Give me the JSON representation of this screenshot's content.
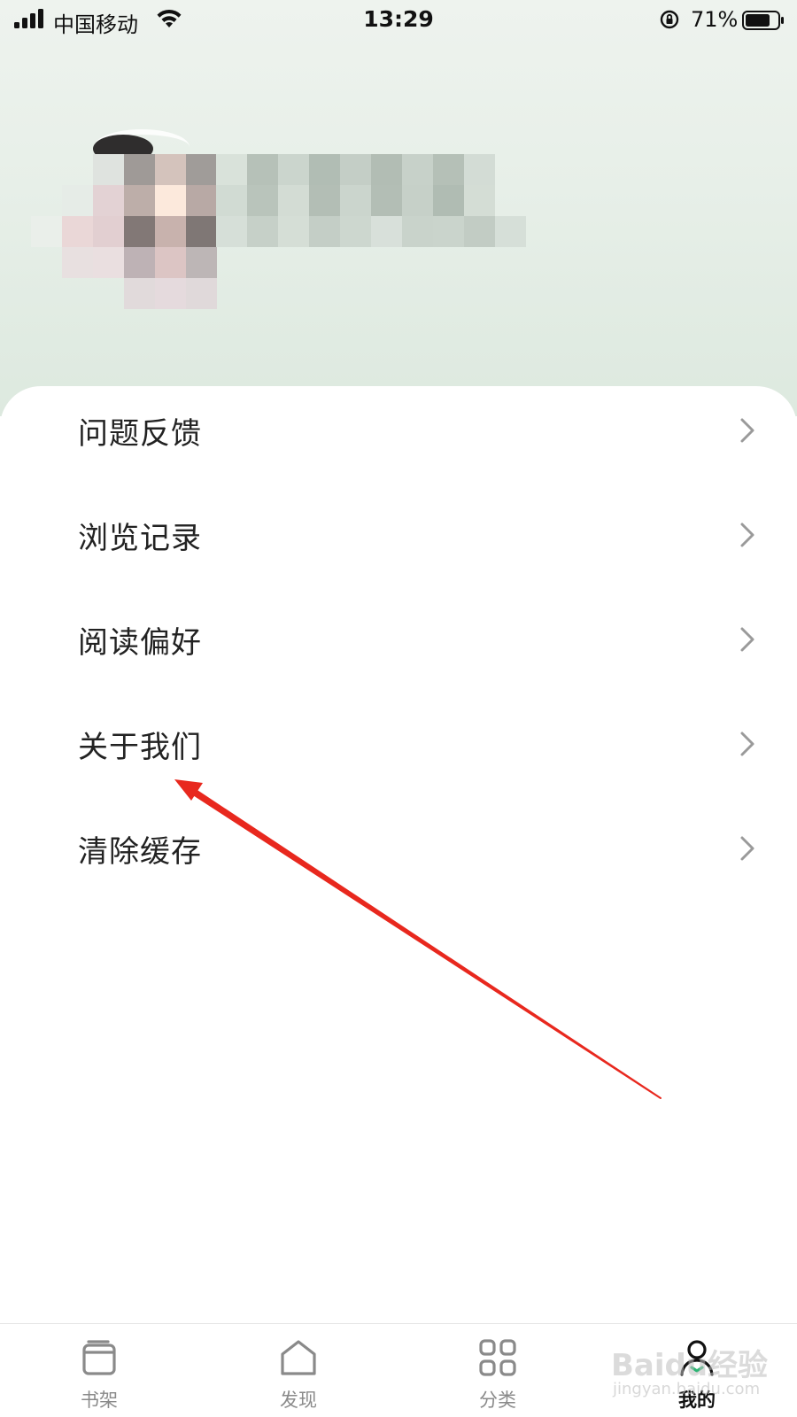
{
  "status_bar": {
    "carrier": "中国移动",
    "time": "13:29",
    "battery_percent": "71%",
    "icons": [
      "signal-icon",
      "wifi-icon",
      "rotation-lock-icon",
      "battery-icon"
    ]
  },
  "profile": {
    "avatar": "blurred-avatar",
    "username": ""
  },
  "menu": {
    "items": [
      {
        "label": "问题反馈",
        "icon": "chevron-right-icon"
      },
      {
        "label": "浏览记录",
        "icon": "chevron-right-icon"
      },
      {
        "label": "阅读偏好",
        "icon": "chevron-right-icon"
      },
      {
        "label": "关于我们",
        "icon": "chevron-right-icon"
      },
      {
        "label": "清除缓存",
        "icon": "chevron-right-icon"
      }
    ]
  },
  "annotation": {
    "type": "arrow",
    "color": "#e8281e",
    "target": "关于我们"
  },
  "tabbar": {
    "items": [
      {
        "label": "书架",
        "icon": "bookshelf-icon",
        "active": false
      },
      {
        "label": "发现",
        "icon": "home-icon",
        "active": false
      },
      {
        "label": "分类",
        "icon": "grid-icon",
        "active": false
      },
      {
        "label": "我的",
        "icon": "person-icon",
        "active": true
      }
    ],
    "active_color": "#2bb673"
  },
  "watermark": {
    "text": "Baidu经验",
    "sub": "jingyan.baidu.com"
  }
}
